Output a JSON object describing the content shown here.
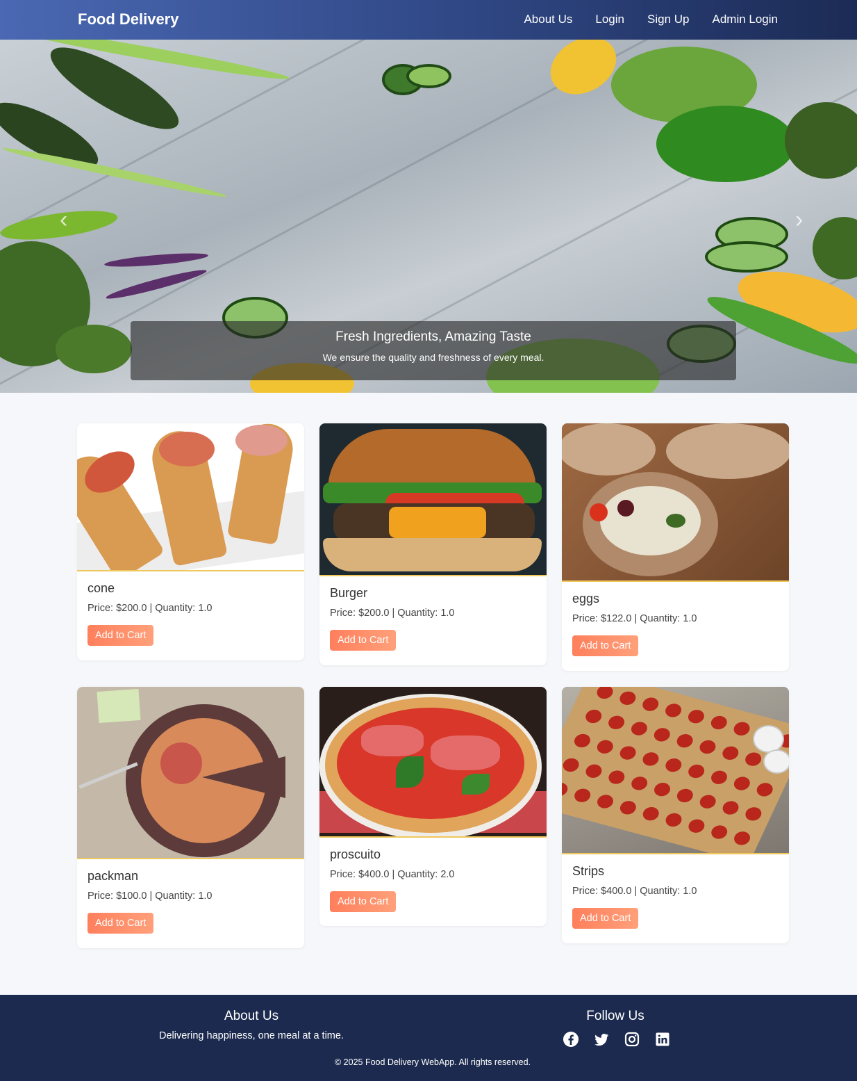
{
  "nav": {
    "brand": "Food Delivery",
    "links": [
      "About Us",
      "Login",
      "Sign Up",
      "Admin Login"
    ]
  },
  "hero": {
    "caption_title": "Fresh Ingredients, Amazing Taste",
    "caption_text": "We ensure the quality and freshness of every meal.",
    "prev_icon": "chevron-left-icon",
    "next_icon": "chevron-right-icon"
  },
  "products": [
    {
      "name": "cone",
      "meta": "Price: $200.0 | Quantity: 1.0",
      "button": "Add to Cart"
    },
    {
      "name": "Burger",
      "meta": "Price: $200.0 | Quantity: 1.0",
      "button": "Add to Cart"
    },
    {
      "name": "eggs",
      "meta": "Price: $122.0 | Quantity: 1.0",
      "button": "Add to Cart"
    },
    {
      "name": "packman",
      "meta": "Price: $100.0 | Quantity: 1.0",
      "button": "Add to Cart"
    },
    {
      "name": "proscuito",
      "meta": "Price: $400.0 | Quantity: 2.0",
      "button": "Add to Cart"
    },
    {
      "name": "Strips",
      "meta": "Price: $400.0 | Quantity: 1.0",
      "button": "Add to Cart"
    }
  ],
  "footer": {
    "about_title": "About Us",
    "about_text": "Delivering happiness, one meal at a time.",
    "follow_title": "Follow Us",
    "social_icons": [
      "facebook-icon",
      "twitter-icon",
      "instagram-icon",
      "linkedin-icon"
    ],
    "copyright": "© 2025 Food Delivery WebApp. All rights reserved."
  },
  "colors": {
    "nav_gradient_start": "#4a68b3",
    "nav_gradient_end": "#1c2b55",
    "button_start": "#ff7f5c",
    "button_end": "#ffa07a",
    "card_divider": "#f0c75a",
    "footer_bg": "#1b2a4e",
    "page_bg": "#f5f7fa"
  }
}
